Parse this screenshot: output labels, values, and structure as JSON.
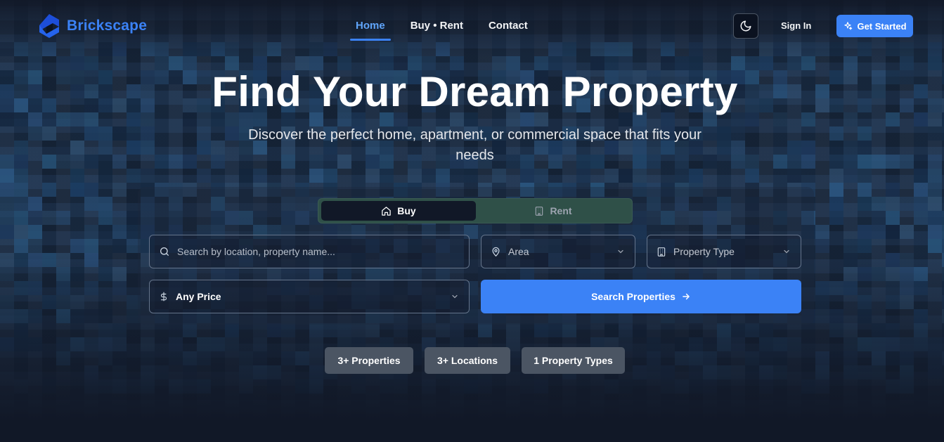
{
  "brand": {
    "name": "Brickscape",
    "color": "#3b82f6"
  },
  "nav": {
    "links": [
      {
        "label": "Home",
        "active": true
      },
      {
        "label": "Buy • Rent"
      },
      {
        "label": "Contact"
      }
    ],
    "theme_toggle_icon": "moon-icon",
    "sign_in_label": "Sign In",
    "get_started_label": "Get Started"
  },
  "hero": {
    "title": "Find Your Dream Property",
    "subtitle": "Discover the perfect home, apartment, or commercial space that fits your needs"
  },
  "search": {
    "mode_tabs": [
      {
        "label": "Buy",
        "icon": "home-icon",
        "selected": true
      },
      {
        "label": "Rent",
        "icon": "building-icon",
        "selected": false
      }
    ],
    "query_placeholder": "Search by location, property name...",
    "area_label": "Area",
    "property_type_label": "Property Type",
    "price_label": "Any Price",
    "submit_label": "Search Properties"
  },
  "stats": [
    {
      "label": "3+ Properties"
    },
    {
      "label": "3+ Locations"
    },
    {
      "label": "1 Property Types"
    }
  ],
  "colors": {
    "accent": "#3b82f6",
    "background": "#111827",
    "toggle_track": "#2f5048",
    "stat_badge": "#4b5563"
  }
}
